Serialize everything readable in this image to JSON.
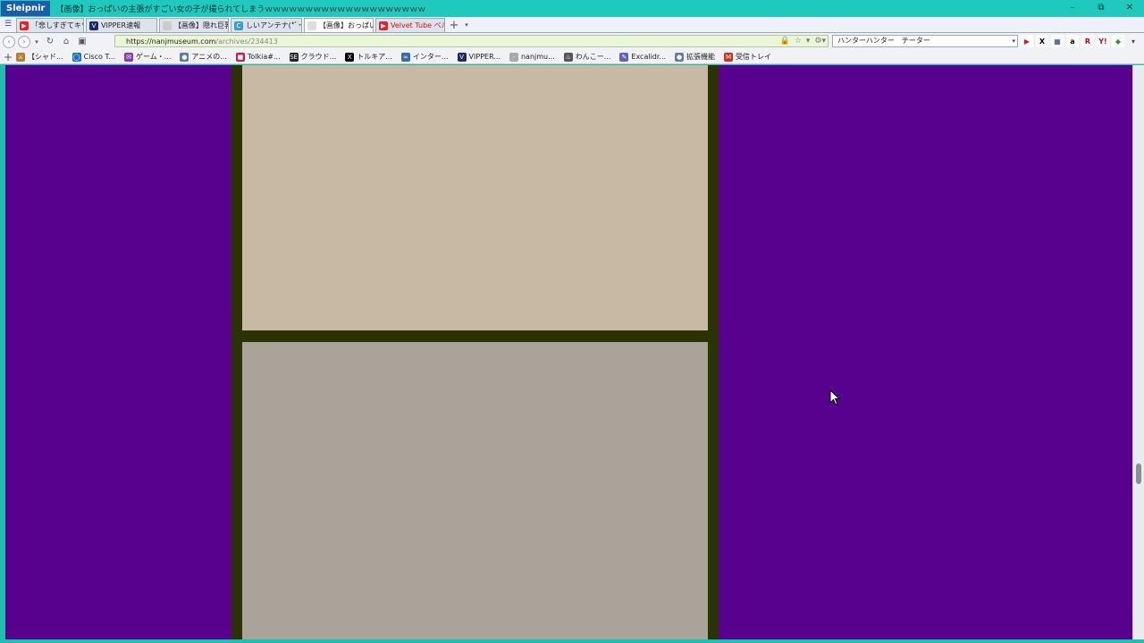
{
  "window": {
    "app_name": "Sleipnir",
    "title": "【画像】おっぱいの主張がすごい女の子が撮られてしまうｗｗｗｗｗｗｗｗｗｗｗｗｗｗｗｗｗｗｗｗ",
    "controls": {
      "minimize": "–",
      "restore": "⧉",
      "close": "✕"
    }
  },
  "tabs": [
    {
      "label": "「悲しすぎてキツい...",
      "favicon_color": "#e5202a",
      "favicon_glyph": "▶",
      "active": false
    },
    {
      "label": "VIPPER速報",
      "favicon_color": "#1a2a6a",
      "favicon_glyph": "V",
      "active": false
    },
    {
      "label": "【画像】隠れ巨乳...",
      "favicon_color": "#cccccc",
      "favicon_glyph": "",
      "active": false
    },
    {
      "label": "しいアンテナ(*ﾟーﾟ)",
      "favicon_color": "#3aa0c8",
      "favicon_glyph": "C",
      "active": false
    },
    {
      "label": "【画像】おっぱいの...",
      "favicon_color": "#dddddd",
      "favicon_glyph": "",
      "active": true
    },
    {
      "label": "Velvet Tube ベル...",
      "favicon_color": "#e5202a",
      "favicon_glyph": "▶",
      "active": false,
      "label_color": "#d01010"
    }
  ],
  "tabbar": {
    "add": "+",
    "dropdown": "▾"
  },
  "navigation": {
    "back": "‹",
    "forward": "›",
    "dropdown": "▾",
    "reload": "↻",
    "home": "⌂",
    "feed": "▣",
    "url_host": "https://nanjmuseum.com",
    "url_path": "/archives/234413",
    "url_icons": {
      "lock": "🔒",
      "star": "☆",
      "menu": "▾",
      "gear": "⚙▾"
    },
    "search_value": "ハンターハンター　チーター",
    "search_dropdown": "▾"
  },
  "toolbar_right": [
    {
      "name": "youtube-tool-icon",
      "glyph": "▶",
      "color": "#cc2020",
      "bg": "#ffffff"
    },
    {
      "name": "x-tool-icon",
      "glyph": "X",
      "color": "#000000",
      "bg": "#ffffff"
    },
    {
      "name": "niconico-tool-icon",
      "glyph": "▦",
      "color": "#1a3a8a",
      "bg": "#ffffff"
    },
    {
      "name": "amazon-tool-icon",
      "glyph": "a",
      "color": "#000000",
      "bg": "#ffffff"
    },
    {
      "name": "rakuten-tool-icon",
      "glyph": "R",
      "color": "#bf0000",
      "bg": "#ffffff"
    },
    {
      "name": "yahoo-tool-icon",
      "glyph": "Y!",
      "color": "#d0021b",
      "bg": "#ffffff"
    },
    {
      "name": "extension-tool-icon",
      "glyph": "◆",
      "color": "#2a9a2a",
      "bg": "#ffffff"
    },
    {
      "name": "overflow-tool-icon",
      "glyph": "▾",
      "color": "#444444",
      "bg": "#f0f2f5"
    }
  ],
  "bookmarks": [
    {
      "label": "【シャド...",
      "icon": "⚔",
      "icon_color": "#b08030"
    },
    {
      "label": "Cisco T...",
      "icon": "◯",
      "icon_color": "#1d6fcc"
    },
    {
      "label": "ゲーム・...",
      "icon": "✉",
      "icon_color": "#8a3ab0"
    },
    {
      "label": "アニメの...",
      "icon": "●",
      "icon_color": "#5a7ab0"
    },
    {
      "label": "Tolkia#...",
      "icon": "■",
      "icon_color": "#d01a4a"
    },
    {
      "label": "クラウド...",
      "icon": "SE",
      "icon_color": "#222222"
    },
    {
      "label": "トルキア...",
      "icon": "X",
      "icon_color": "#000000"
    },
    {
      "label": "インター...",
      "icon": "∞",
      "icon_color": "#3a6ab0"
    },
    {
      "label": "VIPPER...",
      "icon": "V",
      "icon_color": "#1a2a6a"
    },
    {
      "label": "nanjmu...",
      "icon": "·",
      "icon_color": "#aaaaaa"
    },
    {
      "label": "わんこー...",
      "icon": "♨",
      "icon_color": "#555555"
    },
    {
      "label": "Excalidr...",
      "icon": "✎",
      "icon_color": "#6060c0"
    },
    {
      "label": "拡張機能",
      "icon": "●",
      "icon_color": "#6080a0"
    },
    {
      "label": "受信トレイ",
      "icon": "M",
      "icon_color": "#d03020"
    }
  ],
  "colors": {
    "page_background": "#58018e",
    "article_frame": "#2b3204",
    "browser_accent": "#1fc9bd"
  },
  "scrollbar": {
    "position": 0.72
  }
}
